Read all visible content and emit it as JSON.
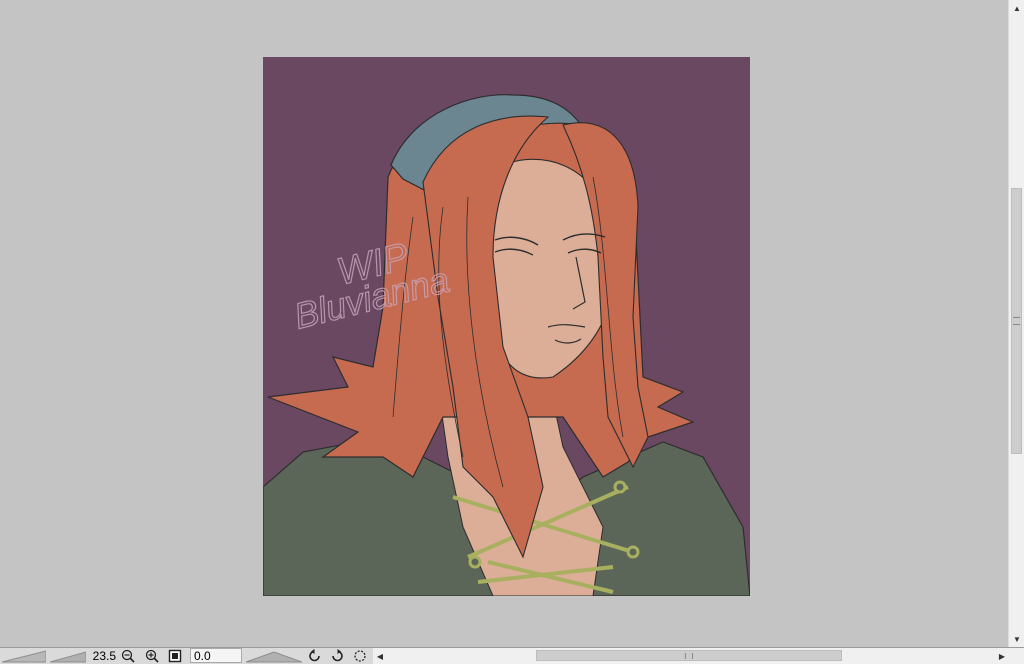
{
  "artwork": {
    "watermark_line1": "WIP",
    "watermark_line2": "Bluvianna",
    "background_color": "#6a4862",
    "hair_color": "#c66a50",
    "skin_color": "#dcae98",
    "hat_color": "#6b8690",
    "coat_color": "#5c6658",
    "lace_color": "#a8b060"
  },
  "statusbar": {
    "zoom_value": "23.5",
    "zoom_out_icon": "zoom-out-icon",
    "zoom_in_icon": "zoom-in-icon",
    "fit_icon": "fit-screen-icon",
    "rotation_value": "0.0",
    "rotate_left_icon": "rotate-left-icon",
    "rotate_right_icon": "rotate-right-icon",
    "reset_rotation_icon": "reset-rotation-icon"
  },
  "scrollbars": {
    "vertical_position": 0.42,
    "horizontal_position": 0.5
  }
}
